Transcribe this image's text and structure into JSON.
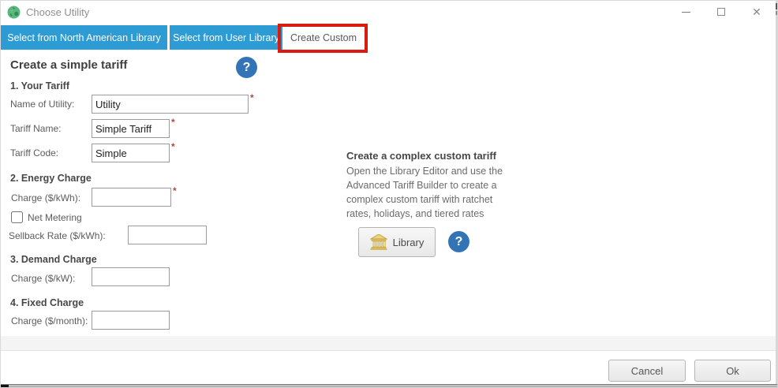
{
  "colors": {
    "tab_blue": "#2d9bd4",
    "help_blue": "#3274b5",
    "annotation_red": "#da1b10",
    "required_asterisk": "#aa4b3e"
  },
  "window": {
    "title": "Choose Utility",
    "close_glyph": "✕"
  },
  "tabs": {
    "north_american": "Select from North American Library",
    "user_library": "Select from User Library",
    "create_custom": "Create Custom"
  },
  "help": {
    "glyph": "?"
  },
  "simple": {
    "heading": "Create a simple tariff",
    "section1_title": "1. Your Tariff",
    "name_of_utility": {
      "label": "Name of Utility:",
      "value": "Utility",
      "required": "*"
    },
    "tariff_name": {
      "label": "Tariff Name:",
      "value": "Simple Tariff",
      "required": "*"
    },
    "tariff_code": {
      "label": "Tariff Code:",
      "value": "Simple",
      "required": "*"
    },
    "section2_title": "2. Energy Charge",
    "energy_charge": {
      "label": "Charge ($/kWh):",
      "value": "",
      "required": "*"
    },
    "net_metering": {
      "label": "Net Metering",
      "checked": false
    },
    "sellback_rate": {
      "label": "Sellback Rate ($/kWh):",
      "value": ""
    },
    "section3_title": "3. Demand Charge",
    "demand_charge": {
      "label": "Charge ($/kW):",
      "value": ""
    },
    "section4_title": "4. Fixed Charge",
    "fixed_charge": {
      "label": "Charge ($/month):",
      "value": ""
    }
  },
  "complex": {
    "heading": "Create a complex custom tariff",
    "lines": [
      "Open the Library Editor and use the",
      "Advanced Tariff Builder to create a",
      "complex custom tariff with ratchet",
      "rates, holidays, and tiered rates"
    ],
    "library_button": "Library"
  },
  "footer": {
    "cancel": "Cancel",
    "ok": "Ok"
  }
}
